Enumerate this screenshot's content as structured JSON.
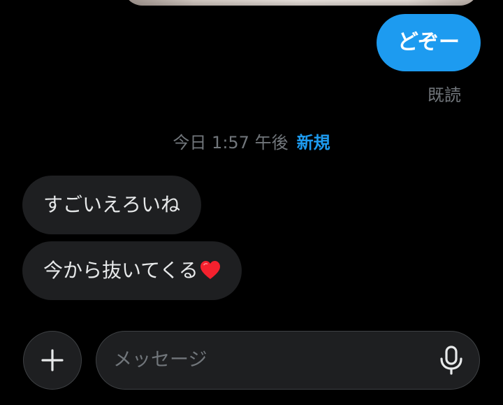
{
  "conversation": {
    "sent_messages": [
      {
        "text": "どぞー"
      }
    ],
    "read_receipt": "既読",
    "divider": {
      "date_text": "今日 1:57 午後",
      "new_label": "新規"
    },
    "received_messages": [
      {
        "text": "すごいえろいね"
      },
      {
        "text": "今から抜いてくる",
        "emoji": "red-heart"
      }
    ]
  },
  "composer": {
    "add_icon": "plus-icon",
    "input_value": "",
    "placeholder": "メッセージ",
    "mic_icon": "microphone-icon"
  },
  "colors": {
    "background": "#000000",
    "accent": "#1d9bf0",
    "bubble_received": "#1e1f21",
    "muted_text": "#71767b",
    "heart": "#f4212e"
  }
}
